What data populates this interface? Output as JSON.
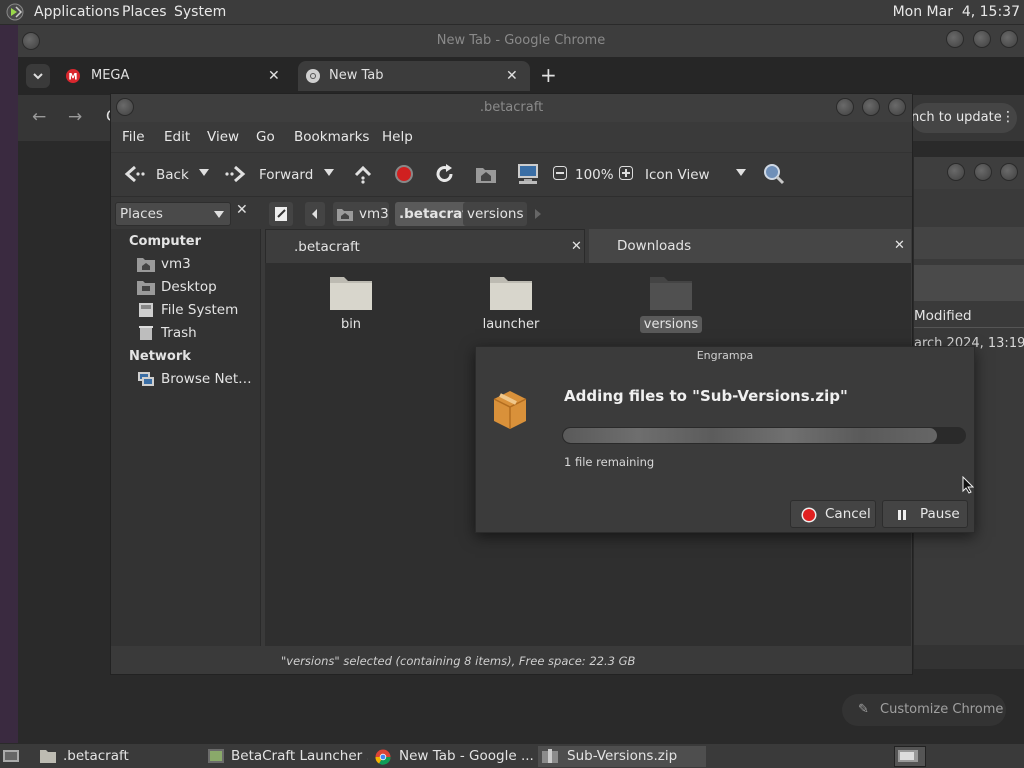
{
  "top_panel": {
    "menu": [
      "Applications",
      "Places",
      "System"
    ],
    "clock": "Mon Mar  4, 15:37"
  },
  "chrome": {
    "window_title": "New Tab - Google Chrome",
    "tabs": [
      {
        "label": "MEGA",
        "icon": "mega-icon"
      },
      {
        "label": "New Tab",
        "icon": "chrome-icon"
      }
    ],
    "update_button": "nch to update",
    "customize_label": "Customize Chrome",
    "partial_toolbar_char": "C"
  },
  "background_window": {
    "column_label": "Modified",
    "row_date": "arch 2024, 13:19"
  },
  "caja": {
    "window_title": ".betacraft",
    "menu": [
      "File",
      "Edit",
      "View",
      "Go",
      "Bookmarks",
      "Help"
    ],
    "toolbar": {
      "back": "Back",
      "forward": "Forward",
      "zoom": "100%",
      "view_mode": "Icon View"
    },
    "places_label": "Places",
    "breadcrumbs": [
      "vm3",
      ".betacraft",
      "versions"
    ],
    "sidebar": {
      "computer_header": "Computer",
      "computer_items": [
        "vm3",
        "Desktop",
        "File System",
        "Trash"
      ],
      "network_header": "Network",
      "network_items": [
        "Browse Net…"
      ]
    },
    "pane_tabs": [
      ".betacraft",
      "Downloads"
    ],
    "folders": [
      "bin",
      "launcher",
      "versions"
    ],
    "status": "\"versions\" selected (containing 8 items), Free space: 22.3 GB"
  },
  "engrampa": {
    "title": "Engrampa",
    "heading": "Adding files to \"Sub-Versions.zip\"",
    "remaining": "1 file remaining",
    "progress": 0.93,
    "cancel": "Cancel",
    "pause": "Pause"
  },
  "taskbar": {
    "items": [
      ".betacraft",
      "BetaCraft Launcher ...",
      "New Tab - Google ...",
      "Sub-Versions.zip"
    ]
  },
  "colors": {
    "accent_red": "#e02020",
    "mega_red": "#d9272e",
    "selected_bg": "#5a5a5a",
    "folder": "#d8d6cc"
  }
}
